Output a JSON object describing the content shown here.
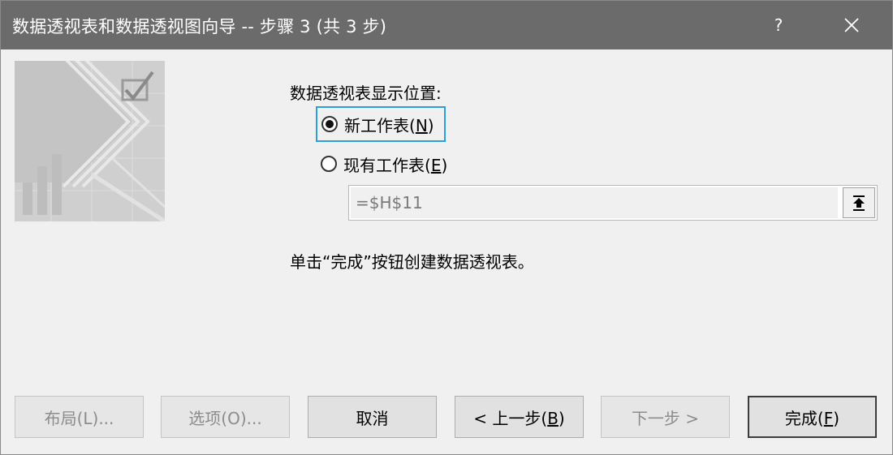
{
  "window": {
    "title": "数据透视表和数据透视图向导 -- 步骤 3 (共 3 步)",
    "help_label": "?",
    "colors": {
      "titlebar": "#6b6b6b",
      "focus_border": "#2a9fd8",
      "background": "#f0f0f0"
    }
  },
  "banner": {
    "icon": "pivot-wizard-banner-icon"
  },
  "placement": {
    "label": "数据透视表显示位置:",
    "options": [
      {
        "label_prefix": "新工作表(",
        "hotkey": "N",
        "label_suffix": ")",
        "selected": true
      },
      {
        "label_prefix": "现有工作表(",
        "hotkey": "E",
        "label_suffix": ")",
        "selected": false
      }
    ],
    "reference_value": "=$H$11",
    "collapse_icon": "collapse-dialog-icon"
  },
  "instruction": "单击“完成”按钮创建数据透视表。",
  "buttons": {
    "layout": {
      "prefix": "布局(L)...",
      "enabled": false
    },
    "options": {
      "prefix": "选项(O)...",
      "enabled": false
    },
    "cancel": {
      "label": "取消",
      "enabled": true
    },
    "back": {
      "prefix": "< 上一步(",
      "hotkey": "B",
      "suffix": ")",
      "enabled": true
    },
    "next": {
      "label": "下一步 >",
      "enabled": false
    },
    "finish": {
      "prefix": "完成(",
      "hotkey": "F",
      "suffix": ")",
      "enabled": true,
      "default": true
    }
  }
}
